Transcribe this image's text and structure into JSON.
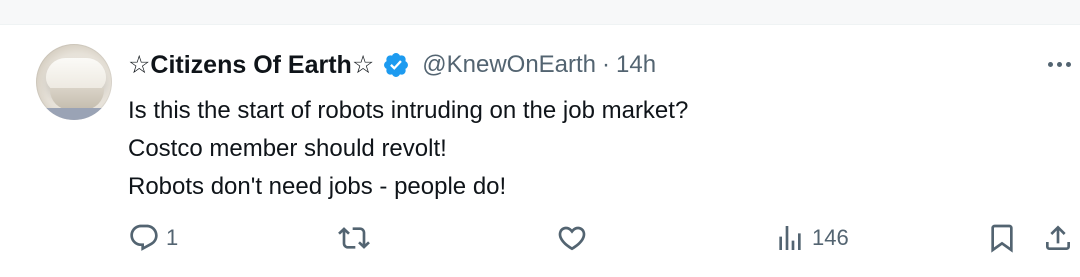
{
  "tweet": {
    "display_name": "☆Citizens Of Earth☆",
    "handle": "@KnewOnEarth",
    "separator": "·",
    "time": "14h",
    "lines": [
      "Is this the start of robots intruding on the job market?",
      "Costco member should revolt!",
      "Robots don't need jobs - people do!"
    ],
    "actions": {
      "reply_count": "1",
      "views_count": "146"
    },
    "verified_badge_color": "#1d9bf0",
    "icons": [
      "more-icon",
      "reply-icon",
      "retweet-icon",
      "like-icon",
      "views-icon",
      "bookmark-icon",
      "share-icon"
    ]
  }
}
